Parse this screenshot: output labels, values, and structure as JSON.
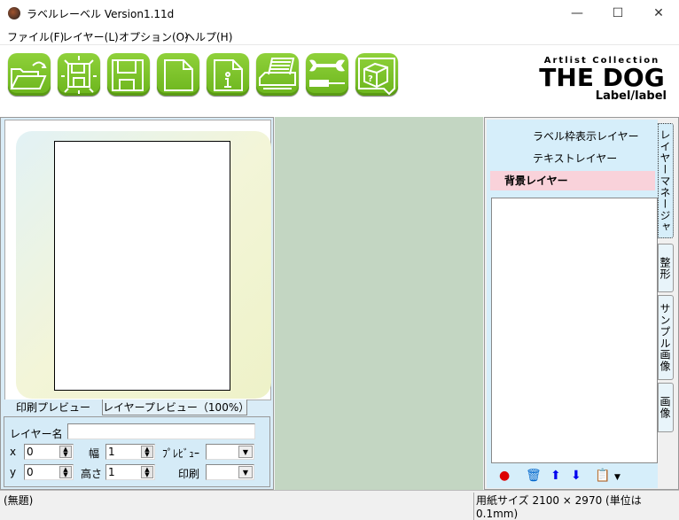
{
  "window": {
    "title": "ラベルレーベル Version1.11d",
    "minimize": "—",
    "maximize": "☐",
    "close": "✕"
  },
  "menu": [
    "ファイル(F)",
    "レイヤー(L)",
    "オプション(O)",
    "ヘルプ(H)"
  ],
  "toolbar": {
    "buttons": [
      "open-icon",
      "save-as-icon",
      "save-icon",
      "new-icon",
      "info-icon",
      "print-icon",
      "tools-icon",
      "help-icon"
    ],
    "accent": "#7cc12a"
  },
  "logo": {
    "line1": "Artlist Collection",
    "line2": "THE DOG",
    "line3": "Label/label"
  },
  "preview_tabs": [
    "印刷プレビュー",
    "レイヤープレビュー（100%）"
  ],
  "props": {
    "layer_name_label": "レイヤー名",
    "layer_name_value": "",
    "x_label": "x",
    "x_value": "0",
    "y_label": "y",
    "y_value": "0",
    "width_label": "幅",
    "width_value": "1",
    "height_label": "高さ",
    "height_value": "1",
    "preview_label": "ﾌﾟﾚﾋﾞｭｰ",
    "preview_value": "",
    "print_label": "印刷",
    "print_value": ""
  },
  "layers": [
    "ラベル枠表示レイヤー",
    "テキストレイヤー",
    "背景レイヤー"
  ],
  "side_tabs": [
    "レイヤーマネージャ",
    "整形",
    "サンプル画像",
    "画像"
  ],
  "status": {
    "left": "(無題)",
    "right": "用紙サイズ 2100 × 2970 (単位は0.1mm)"
  }
}
